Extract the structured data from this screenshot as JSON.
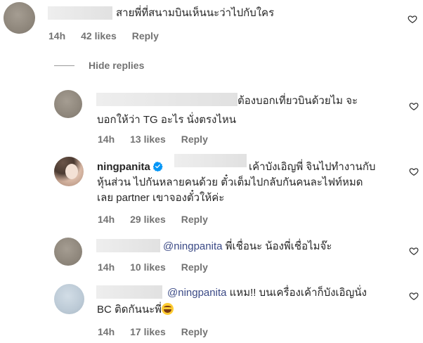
{
  "comments": [
    {
      "text": "สายพี่ที่สนามบินเห็นนะว่าไปกับใคร",
      "time": "14h",
      "likes": "42 likes",
      "reply": "Reply"
    }
  ],
  "hide_replies": "Hide replies",
  "replies": [
    {
      "line1": "ต้องบอกเที่ยวบินด้วยไม จะ",
      "line2": "บอกให้ว่า TG อะไร นั่งตรงไหน",
      "time": "14h",
      "likes": "13 likes",
      "reply": "Reply"
    },
    {
      "username": "ningpanita",
      "line1": "เค้าบังเอิญพี่ จินไปทำงานกับ",
      "line2": "หุ้นส่วน ไปกันหลายคนด้วย ตั๋วเต็มไปกลับกันคนละไฟท์หมด",
      "line3": "เลย partner เขาจองตั๋วให้ค่ะ",
      "time": "14h",
      "likes": "29 likes",
      "reply": "Reply"
    },
    {
      "mention": "@ningpanita",
      "line1": " พี่เชื่อนะ น้องพี่เชื่อไมจ๊ะ",
      "time": "14h",
      "likes": "10 likes",
      "reply": "Reply"
    },
    {
      "mention": "@ningpanita",
      "line1": " แหม!! บนเครื่องเค้าก็บังเอิญนั่ง",
      "line2": "BC ติดกันนะพี่",
      "emoji": "face-with-tears-of-joy",
      "time": "14h",
      "likes": "17 likes",
      "reply": "Reply"
    }
  ],
  "colors": {
    "text": "#262626",
    "meta": "#737373",
    "mention": "#3b4a86",
    "verified": "#0095f6"
  }
}
